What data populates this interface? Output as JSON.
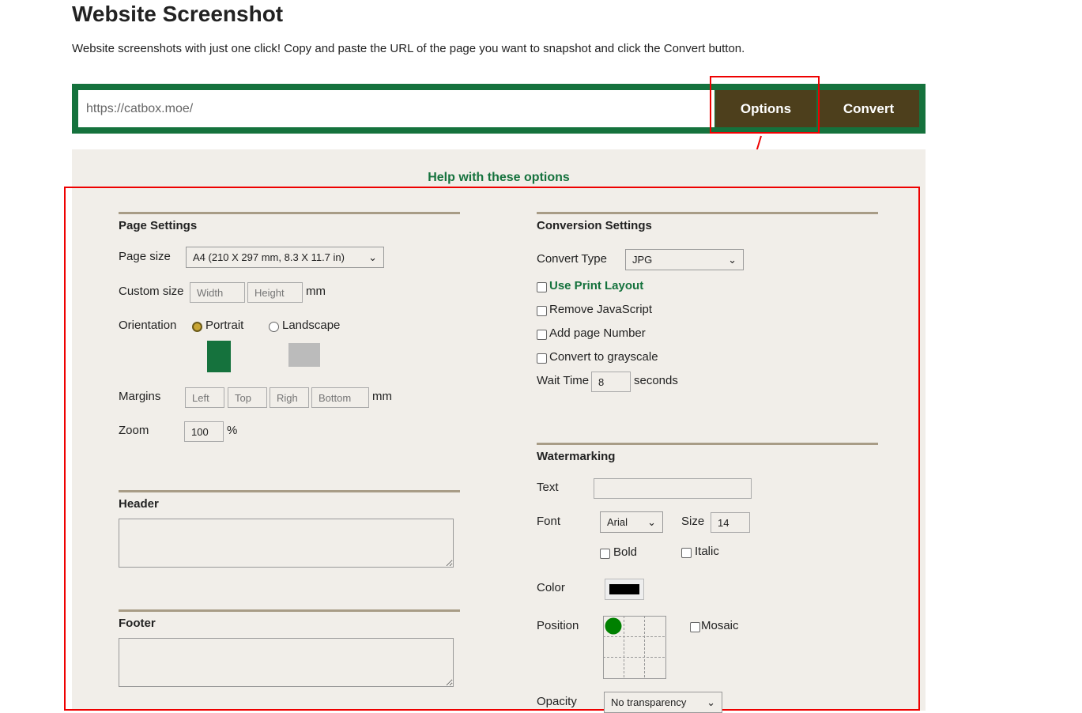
{
  "title": "Website Screenshot",
  "description": "Website screenshots with just one click! Copy and paste the URL of the page you want to snapshot and click the Convert button.",
  "url_input": {
    "value": "https://catbox.moe/"
  },
  "buttons": {
    "options": "Options",
    "convert": "Convert"
  },
  "help_link": "Help with these options",
  "page_settings": {
    "heading": "Page Settings",
    "page_size_label": "Page size",
    "page_size_value": "A4 (210 X 297 mm, 8.3 X 11.7 in)",
    "custom_size_label": "Custom size",
    "width_ph": "Width",
    "height_ph": "Height",
    "mm": "mm",
    "orientation_label": "Orientation",
    "portrait": "Portrait",
    "landscape": "Landscape",
    "margins_label": "Margins",
    "left_ph": "Left",
    "top_ph": "Top",
    "right_ph": "Righ",
    "bottom_ph": "Bottom",
    "zoom_label": "Zoom",
    "zoom_value": "100",
    "percent": "%"
  },
  "header": {
    "heading": "Header"
  },
  "footer": {
    "heading": "Footer"
  },
  "conversion": {
    "heading": "Conversion Settings",
    "convert_type_label": "Convert Type",
    "convert_type_value": "JPG",
    "print_layout": "Use Print Layout",
    "remove_js": "Remove JavaScript",
    "page_number": "Add page Number",
    "grayscale": "Convert to grayscale",
    "wait_label": "Wait Time",
    "wait_value": "8",
    "seconds": "seconds"
  },
  "watermark": {
    "heading": "Watermarking",
    "text_label": "Text",
    "font_label": "Font",
    "font_value": "Arial",
    "size_label": "Size",
    "size_value": "14",
    "bold": "Bold",
    "italic": "Italic",
    "color_label": "Color",
    "color_value": "#000000",
    "position_label": "Position",
    "mosaic": "Mosaic",
    "opacity_label": "Opacity",
    "opacity_value": "No transparency"
  },
  "colors": {
    "brand_green": "#15723d",
    "button_brown": "#4d3f1c",
    "annotation_red": "#e00000"
  }
}
